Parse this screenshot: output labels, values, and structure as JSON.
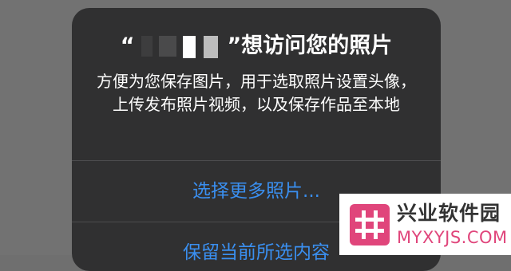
{
  "alert": {
    "title_open_quote": "“",
    "title_rest": "”想访问您的照片",
    "message": "方便为您保存图片，用于选取照片设置头像，上传发布照片视频，以及保存作品至本地",
    "actions": [
      {
        "label": "选择更多照片..."
      },
      {
        "label": "保留当前所选内容"
      }
    ]
  },
  "watermark": {
    "site_name": "兴业软件园",
    "domain": "MYXYJS.COM",
    "logo_color": "#e0457b"
  }
}
